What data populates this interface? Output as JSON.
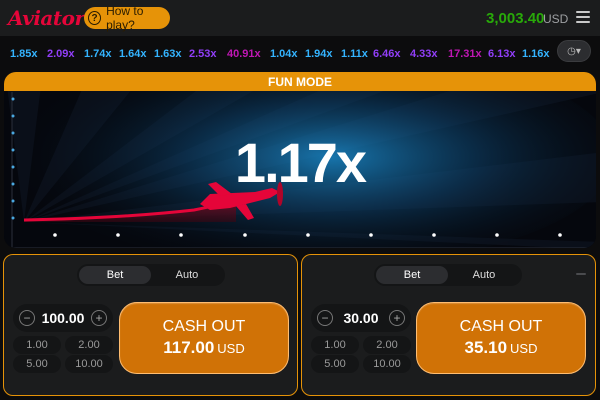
{
  "header": {
    "logo": "Aviator",
    "how_to_play": "How to play?",
    "balance": "3,003.40",
    "currency": "USD"
  },
  "history": {
    "items": [
      {
        "value": "1.85x",
        "color": "#34b4ff"
      },
      {
        "value": "2.09x",
        "color": "#913ef8"
      },
      {
        "value": "1.74x",
        "color": "#34b4ff"
      },
      {
        "value": "1.64x",
        "color": "#34b4ff"
      },
      {
        "value": "1.63x",
        "color": "#34b4ff"
      },
      {
        "value": "2.53x",
        "color": "#913ef8"
      },
      {
        "value": "40.91x",
        "color": "#c017b4"
      },
      {
        "value": "1.04x",
        "color": "#34b4ff"
      },
      {
        "value": "1.94x",
        "color": "#34b4ff"
      },
      {
        "value": "1.11x",
        "color": "#34b4ff"
      },
      {
        "value": "6.46x",
        "color": "#913ef8"
      },
      {
        "value": "4.33x",
        "color": "#913ef8"
      },
      {
        "value": "17.31x",
        "color": "#c017b4"
      },
      {
        "value": "6.13x",
        "color": "#913ef8"
      },
      {
        "value": "1.16x",
        "color": "#34b4ff"
      }
    ]
  },
  "game": {
    "mode_banner": "FUN MODE",
    "multiplier": "1.17x",
    "plane_color": "#e50539"
  },
  "panels": [
    {
      "tabs": [
        "Bet",
        "Auto"
      ],
      "active_tab": "Bet",
      "amount": "100.00",
      "chips": [
        "1.00",
        "2.00",
        "5.00",
        "10.00"
      ],
      "cashout_label": "CASH OUT",
      "cashout_amount": "117.00",
      "cashout_currency": "USD"
    },
    {
      "tabs": [
        "Bet",
        "Auto"
      ],
      "active_tab": "Bet",
      "amount": "30.00",
      "chips": [
        "1.00",
        "2.00",
        "5.00",
        "10.00"
      ],
      "cashout_label": "CASH OUT",
      "cashout_amount": "35.10",
      "cashout_currency": "USD"
    }
  ],
  "colors": {
    "accent": "#e69308",
    "balance": "#28a909",
    "brand": "#e50539"
  }
}
